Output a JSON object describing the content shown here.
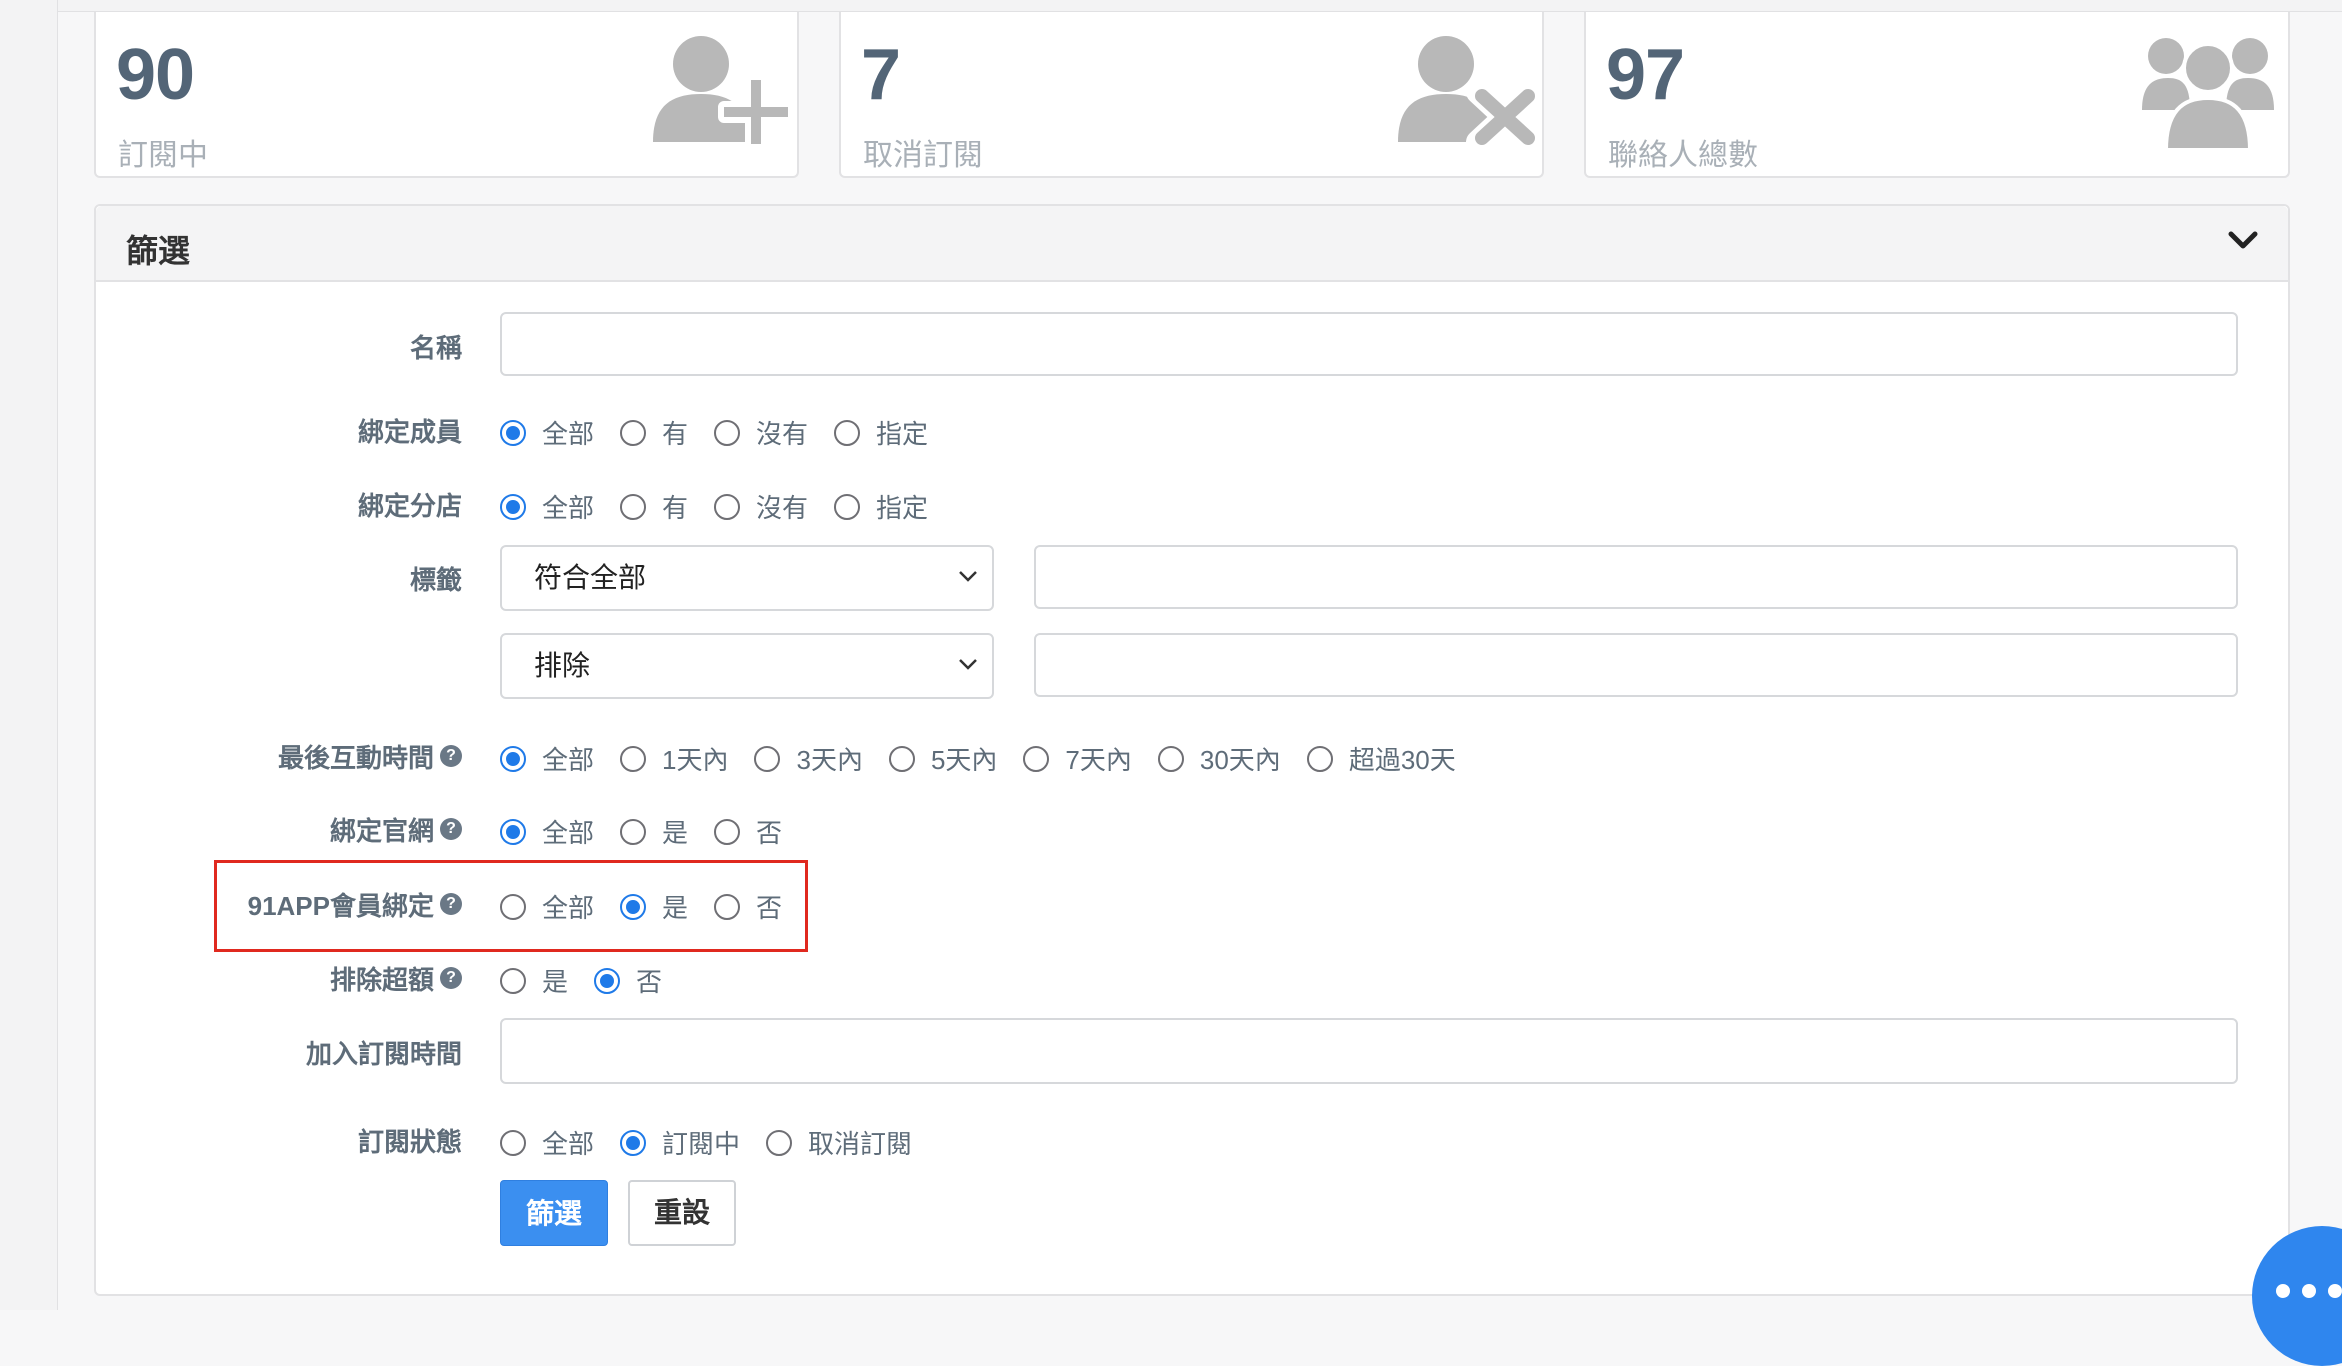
{
  "stats": [
    {
      "value": "90",
      "label": "訂閱中",
      "icon": "user-plus-icon"
    },
    {
      "value": "7",
      "label": "取消訂閱",
      "icon": "user-remove-icon"
    },
    {
      "value": "97",
      "label": "聯絡人總數",
      "icon": "users-icon"
    }
  ],
  "filter": {
    "title": "篩選",
    "name_label": "名稱",
    "name_value": "",
    "bind_member": {
      "label": "綁定成員",
      "options": [
        "全部",
        "有",
        "沒有",
        "指定"
      ],
      "selected": "全部"
    },
    "bind_store": {
      "label": "綁定分店",
      "options": [
        "全部",
        "有",
        "沒有",
        "指定"
      ],
      "selected": "全部"
    },
    "tags": {
      "label": "標籤",
      "match_select": "符合全部",
      "exclude_select": "排除",
      "match_value": "",
      "exclude_value": ""
    },
    "last_interaction": {
      "label": "最後互動時間",
      "options": [
        "全部",
        "1天內",
        "3天內",
        "5天內",
        "7天內",
        "30天內",
        "超過30天"
      ],
      "selected": "全部"
    },
    "bind_site": {
      "label": "綁定官網",
      "options": [
        "全部",
        "是",
        "否"
      ],
      "selected": "全部"
    },
    "bind_91app": {
      "label": "91APP會員綁定",
      "options": [
        "全部",
        "是",
        "否"
      ],
      "selected": "是"
    },
    "exclude_over": {
      "label": "排除超額",
      "options": [
        "是",
        "否"
      ],
      "selected": "否"
    },
    "join_time": {
      "label": "加入訂閱時間",
      "value": ""
    },
    "sub_status": {
      "label": "訂閱狀態",
      "options": [
        "全部",
        "訂閱中",
        "取消訂閱"
      ],
      "selected": "訂閱中"
    },
    "submit_label": "篩選",
    "reset_label": "重設"
  },
  "help_glyph": "?",
  "colors": {
    "accent": "#3b8ff0",
    "highlight": "#e0291f",
    "stat_num": "#536577"
  }
}
